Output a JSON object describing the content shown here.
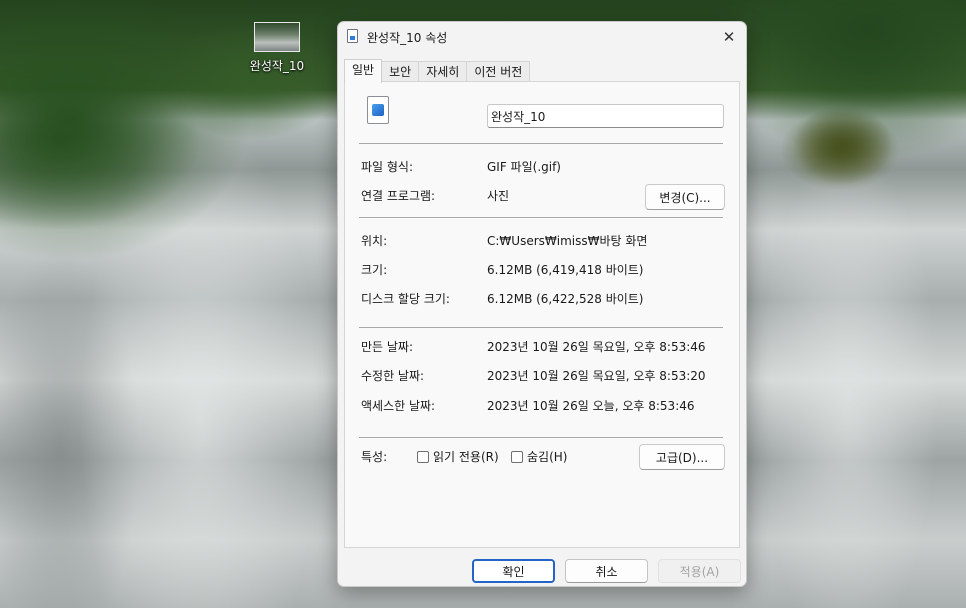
{
  "desktop": {
    "icon_label": "완성작_10"
  },
  "dialog": {
    "title": "완성작_10 속성",
    "close_symbol": "✕",
    "tabs": [
      {
        "label": "일반",
        "active": true
      },
      {
        "label": "보안",
        "active": false
      },
      {
        "label": "자세히",
        "active": false
      },
      {
        "label": "이전 버전",
        "active": false
      }
    ],
    "general": {
      "file_name": "완성작_10",
      "file_type_label": "파일 형식:",
      "file_type_value": "GIF 파일(.gif)",
      "opens_with_label": "연결 프로그램:",
      "opens_with_value": "사진",
      "change_button": "변경(C)...",
      "location_label": "위치:",
      "location_value": "C:₩Users₩imiss₩바탕 화면",
      "size_label": "크기:",
      "size_value": "6.12MB (6,419,418 바이트)",
      "size_on_disk_label": "디스크 할당 크기:",
      "size_on_disk_value": "6.12MB (6,422,528 바이트)",
      "created_label": "만든 날짜:",
      "created_value": "2023년 10월 26일 목요일, 오후 8:53:46",
      "modified_label": "수정한 날짜:",
      "modified_value": "2023년 10월 26일 목요일, 오후 8:53:20",
      "accessed_label": "액세스한 날짜:",
      "accessed_value": "2023년 10월 26일 오늘, 오후 8:53:46",
      "attributes_label": "특성:",
      "readonly_label": "읽기 전용(R)",
      "readonly_checked": false,
      "hidden_label": "숨김(H)",
      "hidden_checked": false,
      "advanced_button": "고급(D)..."
    },
    "footer": {
      "ok": "확인",
      "cancel": "취소",
      "apply": "적용(A)"
    },
    "accent_color": "#2564c7"
  }
}
